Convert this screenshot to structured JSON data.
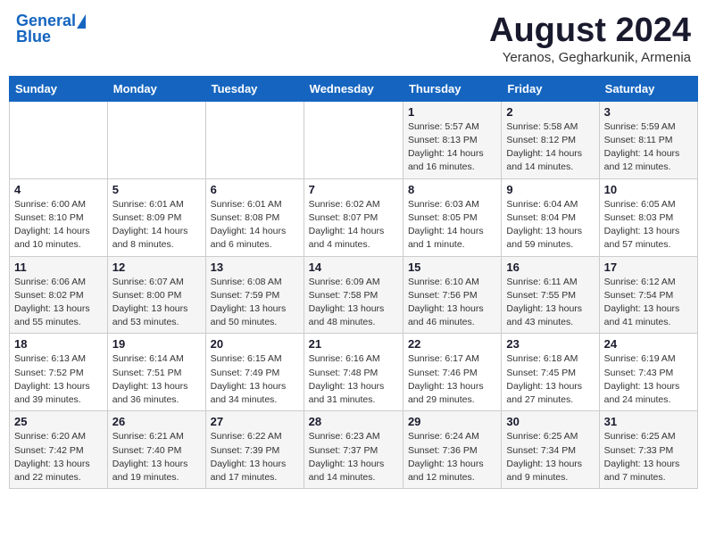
{
  "header": {
    "logo_general": "General",
    "logo_blue": "Blue",
    "month_title": "August 2024",
    "subtitle": "Yeranos, Gegharkunik, Armenia"
  },
  "weekdays": [
    "Sunday",
    "Monday",
    "Tuesday",
    "Wednesday",
    "Thursday",
    "Friday",
    "Saturday"
  ],
  "weeks": [
    [
      {
        "day": "",
        "info": ""
      },
      {
        "day": "",
        "info": ""
      },
      {
        "day": "",
        "info": ""
      },
      {
        "day": "",
        "info": ""
      },
      {
        "day": "1",
        "info": "Sunrise: 5:57 AM\nSunset: 8:13 PM\nDaylight: 14 hours\nand 16 minutes."
      },
      {
        "day": "2",
        "info": "Sunrise: 5:58 AM\nSunset: 8:12 PM\nDaylight: 14 hours\nand 14 minutes."
      },
      {
        "day": "3",
        "info": "Sunrise: 5:59 AM\nSunset: 8:11 PM\nDaylight: 14 hours\nand 12 minutes."
      }
    ],
    [
      {
        "day": "4",
        "info": "Sunrise: 6:00 AM\nSunset: 8:10 PM\nDaylight: 14 hours\nand 10 minutes."
      },
      {
        "day": "5",
        "info": "Sunrise: 6:01 AM\nSunset: 8:09 PM\nDaylight: 14 hours\nand 8 minutes."
      },
      {
        "day": "6",
        "info": "Sunrise: 6:01 AM\nSunset: 8:08 PM\nDaylight: 14 hours\nand 6 minutes."
      },
      {
        "day": "7",
        "info": "Sunrise: 6:02 AM\nSunset: 8:07 PM\nDaylight: 14 hours\nand 4 minutes."
      },
      {
        "day": "8",
        "info": "Sunrise: 6:03 AM\nSunset: 8:05 PM\nDaylight: 14 hours\nand 1 minute."
      },
      {
        "day": "9",
        "info": "Sunrise: 6:04 AM\nSunset: 8:04 PM\nDaylight: 13 hours\nand 59 minutes."
      },
      {
        "day": "10",
        "info": "Sunrise: 6:05 AM\nSunset: 8:03 PM\nDaylight: 13 hours\nand 57 minutes."
      }
    ],
    [
      {
        "day": "11",
        "info": "Sunrise: 6:06 AM\nSunset: 8:02 PM\nDaylight: 13 hours\nand 55 minutes."
      },
      {
        "day": "12",
        "info": "Sunrise: 6:07 AM\nSunset: 8:00 PM\nDaylight: 13 hours\nand 53 minutes."
      },
      {
        "day": "13",
        "info": "Sunrise: 6:08 AM\nSunset: 7:59 PM\nDaylight: 13 hours\nand 50 minutes."
      },
      {
        "day": "14",
        "info": "Sunrise: 6:09 AM\nSunset: 7:58 PM\nDaylight: 13 hours\nand 48 minutes."
      },
      {
        "day": "15",
        "info": "Sunrise: 6:10 AM\nSunset: 7:56 PM\nDaylight: 13 hours\nand 46 minutes."
      },
      {
        "day": "16",
        "info": "Sunrise: 6:11 AM\nSunset: 7:55 PM\nDaylight: 13 hours\nand 43 minutes."
      },
      {
        "day": "17",
        "info": "Sunrise: 6:12 AM\nSunset: 7:54 PM\nDaylight: 13 hours\nand 41 minutes."
      }
    ],
    [
      {
        "day": "18",
        "info": "Sunrise: 6:13 AM\nSunset: 7:52 PM\nDaylight: 13 hours\nand 39 minutes."
      },
      {
        "day": "19",
        "info": "Sunrise: 6:14 AM\nSunset: 7:51 PM\nDaylight: 13 hours\nand 36 minutes."
      },
      {
        "day": "20",
        "info": "Sunrise: 6:15 AM\nSunset: 7:49 PM\nDaylight: 13 hours\nand 34 minutes."
      },
      {
        "day": "21",
        "info": "Sunrise: 6:16 AM\nSunset: 7:48 PM\nDaylight: 13 hours\nand 31 minutes."
      },
      {
        "day": "22",
        "info": "Sunrise: 6:17 AM\nSunset: 7:46 PM\nDaylight: 13 hours\nand 29 minutes."
      },
      {
        "day": "23",
        "info": "Sunrise: 6:18 AM\nSunset: 7:45 PM\nDaylight: 13 hours\nand 27 minutes."
      },
      {
        "day": "24",
        "info": "Sunrise: 6:19 AM\nSunset: 7:43 PM\nDaylight: 13 hours\nand 24 minutes."
      }
    ],
    [
      {
        "day": "25",
        "info": "Sunrise: 6:20 AM\nSunset: 7:42 PM\nDaylight: 13 hours\nand 22 minutes."
      },
      {
        "day": "26",
        "info": "Sunrise: 6:21 AM\nSunset: 7:40 PM\nDaylight: 13 hours\nand 19 minutes."
      },
      {
        "day": "27",
        "info": "Sunrise: 6:22 AM\nSunset: 7:39 PM\nDaylight: 13 hours\nand 17 minutes."
      },
      {
        "day": "28",
        "info": "Sunrise: 6:23 AM\nSunset: 7:37 PM\nDaylight: 13 hours\nand 14 minutes."
      },
      {
        "day": "29",
        "info": "Sunrise: 6:24 AM\nSunset: 7:36 PM\nDaylight: 13 hours\nand 12 minutes."
      },
      {
        "day": "30",
        "info": "Sunrise: 6:25 AM\nSunset: 7:34 PM\nDaylight: 13 hours\nand 9 minutes."
      },
      {
        "day": "31",
        "info": "Sunrise: 6:25 AM\nSunset: 7:33 PM\nDaylight: 13 hours\nand 7 minutes."
      }
    ]
  ]
}
